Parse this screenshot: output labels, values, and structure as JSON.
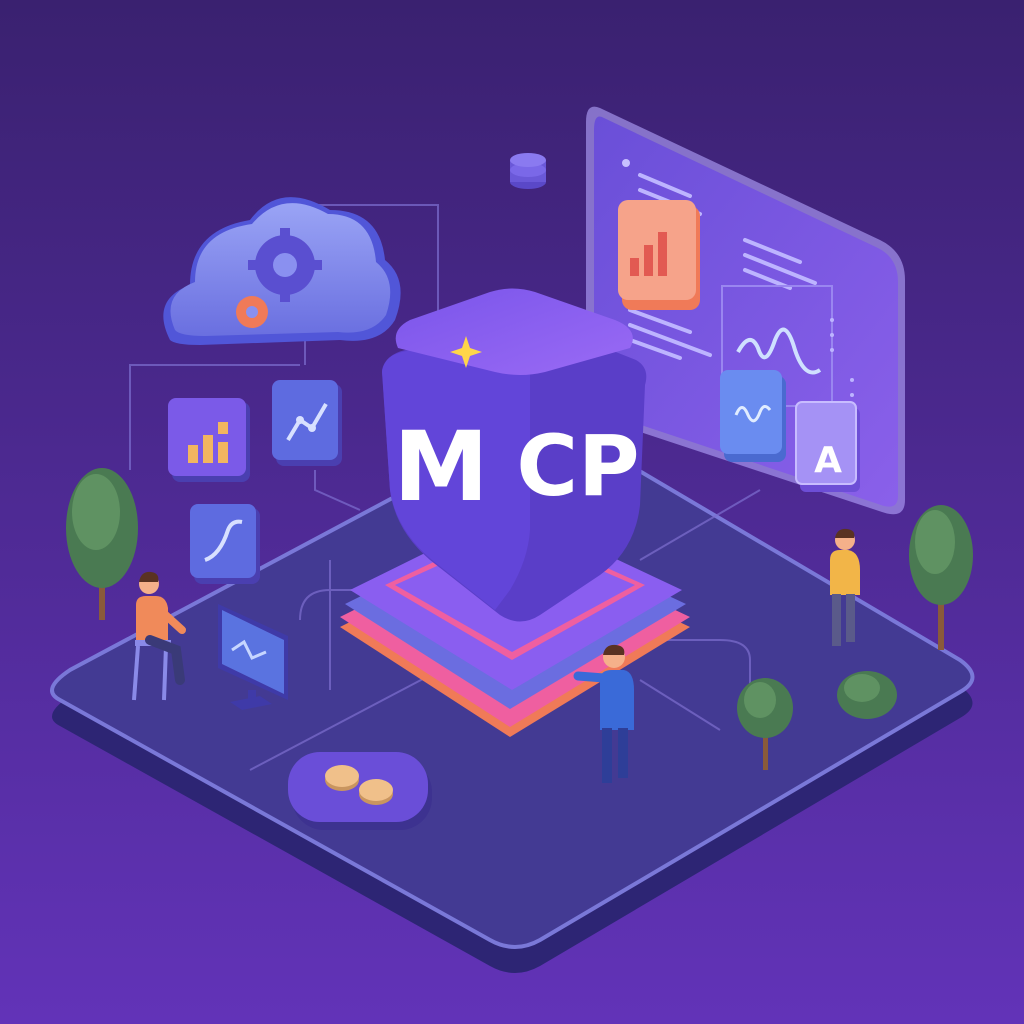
{
  "cube": {
    "letter_left": "M",
    "letter_right": "CP"
  },
  "panel": {
    "tile_letter": "A"
  },
  "colors": {
    "background_top": "#3a2170",
    "background_bottom": "#6233b8",
    "platform_top": "#433a93",
    "platform_edge": "#7a78d8",
    "cube_left": "#6245d9",
    "cube_right": "#5a3ec8",
    "cube_top": "#8a5cf0",
    "ring_orange": "#f07a58",
    "ring_pink": "#ef5fa0",
    "panel_fill": "#7d59e6",
    "cloud_light": "#8f94f2",
    "accent_yellow": "#ffd54a"
  },
  "icons": [
    "cloud-gear-icon",
    "database-icon",
    "bar-chart-icon",
    "line-chart-icon",
    "wave-icon",
    "coins-icon",
    "sparkle-icon",
    "monitor-icon"
  ]
}
